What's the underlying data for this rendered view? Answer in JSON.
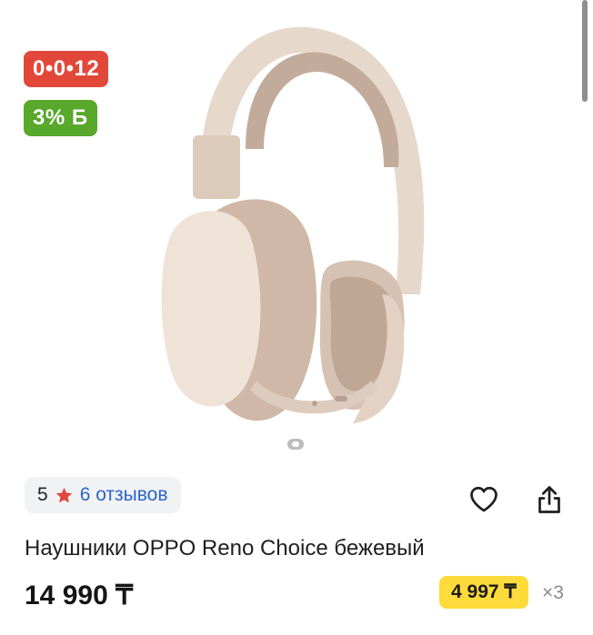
{
  "badges": {
    "timer": "0•0•12",
    "bonus": "3% Б"
  },
  "product": {
    "image_icon": "headphones-image",
    "title": "Наушники OPPO Reno Choice бежевый",
    "price": "14 990 ₸",
    "installment_price": "4 997 ₸",
    "installment_months": "×3"
  },
  "rating": {
    "value": "5",
    "reviews": "6 отзывов"
  },
  "icons": {
    "star": "star-icon",
    "favorite": "heart-icon",
    "share": "share-icon"
  },
  "colors": {
    "timer_badge": "#e2483a",
    "bonus_badge": "#58a82b",
    "installment_badge": "#fddb3a",
    "link": "#2b64c9",
    "star": "#e0463a"
  }
}
